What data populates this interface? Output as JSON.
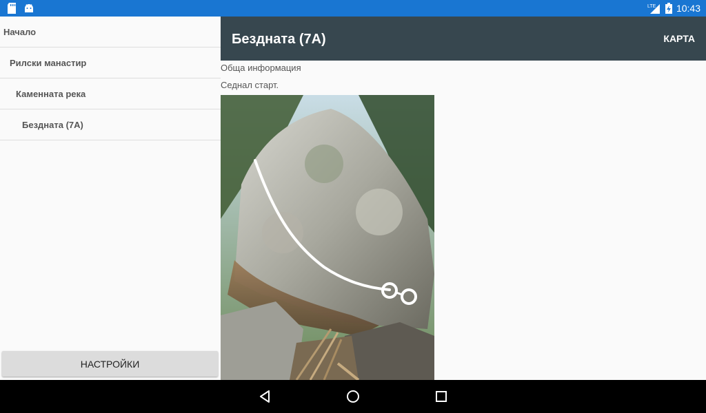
{
  "status_bar": {
    "time": "10:43",
    "network": "LTE",
    "left_icons": [
      "sd-card-icon",
      "android-icon"
    ]
  },
  "drawer": {
    "items": [
      {
        "label": "Начало"
      },
      {
        "label": "Рилски манастир"
      },
      {
        "label": "Каменната река"
      },
      {
        "label": "Бездната (7A)"
      }
    ],
    "settings_label": "НАСТРОЙКИ"
  },
  "toolbar": {
    "title": "Бездната (7A)",
    "map_label": "КАРТА"
  },
  "content": {
    "info_label": "Обща информация",
    "description": "Седнал старт."
  },
  "colors": {
    "status_bar": "#1976d2",
    "toolbar": "#37474f",
    "nav_bar": "#000000"
  }
}
